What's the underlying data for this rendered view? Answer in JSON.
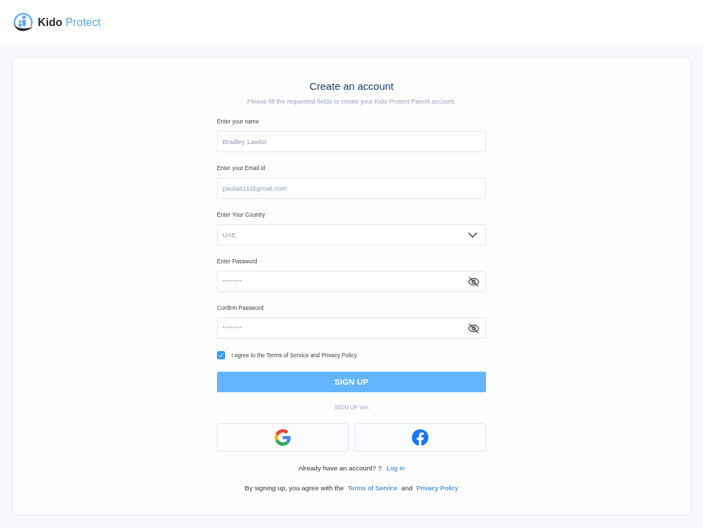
{
  "header": {
    "brand": {
      "primary": "Kido",
      "accent": "Protect"
    }
  },
  "form": {
    "title": "Create an account",
    "subtitle": "Please fill the requested fields to create your Kido Protect Parent account.",
    "fields": [
      {
        "kind": "text",
        "label": "Enter your name",
        "value": "Bradley Lawlor"
      },
      {
        "kind": "text",
        "label": "Enter your Email id",
        "value": "paula611@gmail.com"
      },
      {
        "kind": "select",
        "label": "Enter Your Country",
        "value": "UAE"
      },
      {
        "kind": "password",
        "label": "Enter Password",
        "value": "********"
      },
      {
        "kind": "password",
        "label": "Confirm Password",
        "value": "********"
      }
    ],
    "agreement": {
      "label": "I agree to the Terms of Service and Privacy Policy",
      "checked": true
    },
    "submit": "SIGN UP",
    "social_caption": "SIGN UP VIA",
    "social_buttons": [
      {
        "kind": "google"
      },
      {
        "kind": "facebook"
      }
    ],
    "login_prompt": {
      "text": "Already have an account? ?",
      "link": "Log in"
    },
    "legal": {
      "prefix": "By signing up, you agree with the",
      "terms_link": "Terms of Service",
      "joiner": "and",
      "privacy_link": "Privacy Policy"
    }
  }
}
